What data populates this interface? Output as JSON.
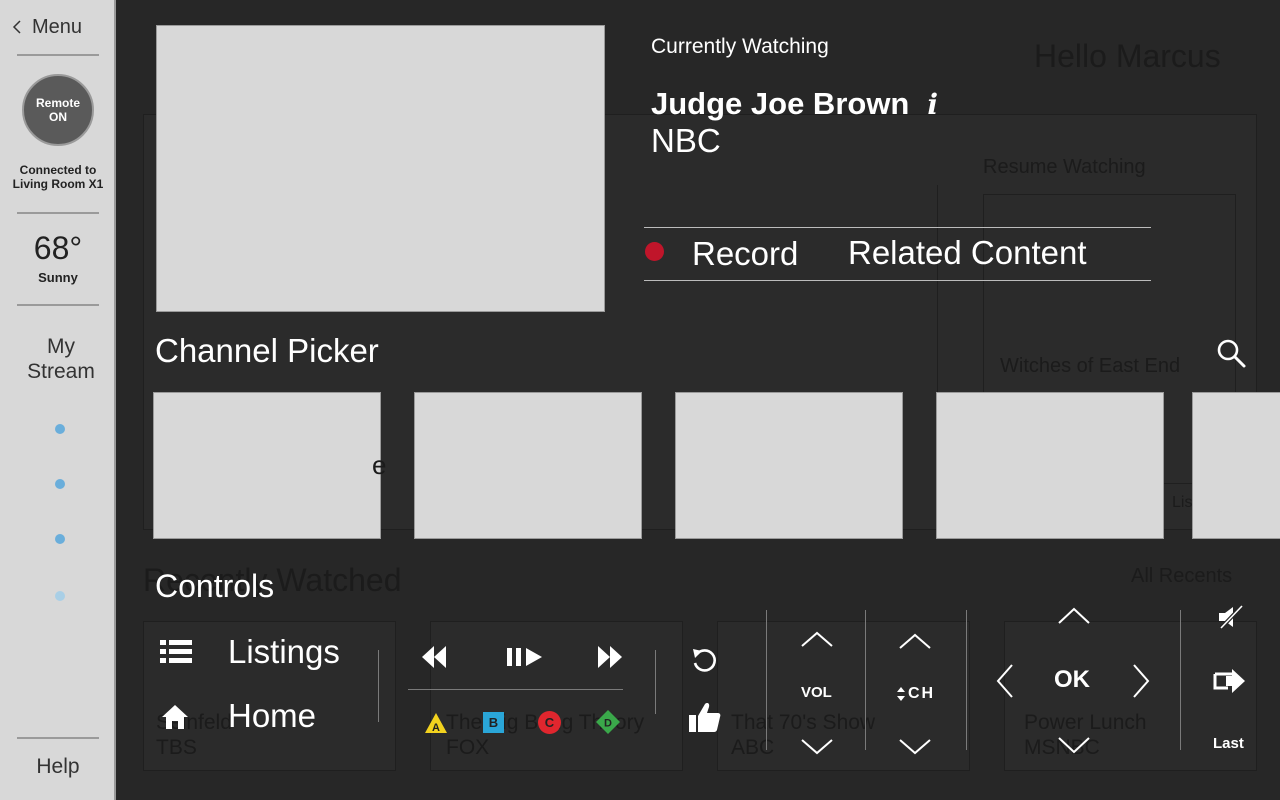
{
  "sidebar": {
    "menu_label": "Menu",
    "remote_line1": "Remote",
    "remote_line2": "ON",
    "connected_line1": "Connected to",
    "connected_line2": "Living Room X1",
    "temperature": "68°",
    "weather": "Sunny",
    "stream_line1": "My",
    "stream_line2": "Stream",
    "help_label": "Help"
  },
  "background": {
    "greeting": "Hello Marcus",
    "resume_watching": "Resume Watching",
    "resume_item": "Witches of East End",
    "recently_watched": "Recently Watched",
    "all_recents": "All Recents",
    "recent_items": [
      {
        "title": "Seinfeld",
        "channel": "TBS"
      },
      {
        "title": "The Big Bang Theory",
        "channel": "FOX"
      },
      {
        "title": "That 70's Show",
        "channel": "ABC"
      },
      {
        "title": "Power Lunch",
        "channel": "MSNBC"
      }
    ],
    "partial_text_1": "e",
    "partial_text_2": "Lis"
  },
  "now_playing": {
    "label": "Currently Watching",
    "show": "Judge Joe Brown",
    "info_glyph": "i",
    "channel": "NBC",
    "record_label": "Record",
    "related_label": "Related Content",
    "record_color": "#c0152a"
  },
  "channel_picker": {
    "title": "Channel Picker"
  },
  "controls": {
    "title": "Controls",
    "listings_label": "Listings",
    "home_label": "Home",
    "vol_label": "VOL",
    "ch_label": "CH",
    "ok_label": "OK",
    "last_label": "Last",
    "color_buttons": [
      {
        "letter": "A",
        "color": "#f2d21e"
      },
      {
        "letter": "B",
        "color": "#2aa6d8"
      },
      {
        "letter": "C",
        "color": "#e0262e"
      },
      {
        "letter": "D",
        "color": "#3aa84a"
      }
    ]
  }
}
